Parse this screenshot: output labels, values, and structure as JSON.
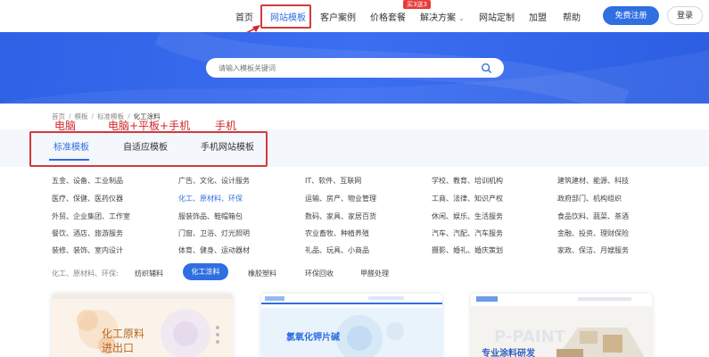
{
  "nav": {
    "items": [
      "首页",
      "网站模板",
      "客户案例",
      "价格套餐",
      "解决方案",
      "网站定制",
      "加盟",
      "帮助"
    ],
    "active_index": 1,
    "hot_badge": "买3送3",
    "register": "免费注册",
    "login": "登录"
  },
  "search": {
    "placeholder": "请输入模板关键词"
  },
  "breadcrumb": [
    "首页",
    "模板",
    "标准模板",
    "化工涂料"
  ],
  "annotations": [
    "电脑",
    "电脑+平板+手机",
    "手机"
  ],
  "tabs": [
    "标准模板",
    "自适应模板",
    "手机网站模板"
  ],
  "categories": [
    [
      "五金、设备、工业制品",
      "广告、文化、设计服务",
      "IT、软件、互联网",
      "学校、教育、培训机构",
      "建筑建材、能源、科技"
    ],
    [
      "医疗、保健、医药仪器",
      "化工、原材料、环保",
      "运输、房产、物业管理",
      "工商、法律、知识产权",
      "政府部门、机构组织"
    ],
    [
      "外贸、企业集团、工作室",
      "服装饰品、鞋帽箱包",
      "数码、家具、家居百货",
      "休闲、娱乐、生活服务",
      "食品饮料、蔬菜、茶酒"
    ],
    [
      "餐饮、酒店、旅游服务",
      "门窗、卫浴、灯光照明",
      "农业畜牧、种植养殖",
      "汽车、汽配、汽车服务",
      "金融、投资、理财保险"
    ],
    [
      "装修、装饰、室内设计",
      "体育、健身、运动器材",
      "礼品、玩具、小商品",
      "摄影、婚礼、婚庆策划",
      "家政、保洁、月嫂服务"
    ]
  ],
  "highlighted_category": "化工、原材料、环保",
  "filter": {
    "label": "化工、原材料、环保:",
    "options": [
      "纺织辅料",
      "化工涂料",
      "橡胶塑料",
      "环保回收",
      "甲醛处理"
    ],
    "active": "化工涂料"
  },
  "cards": {
    "c1_line1": "化工原料",
    "c1_line2": "进出口",
    "c2_title": "氯氧化钾片碱",
    "c3_slogan": "专业涂料研发",
    "c3_bg": "P-PAINT"
  },
  "colors": {
    "accent": "#2f6fe0",
    "annotation": "#d0262b",
    "hero": "#3366e8"
  }
}
